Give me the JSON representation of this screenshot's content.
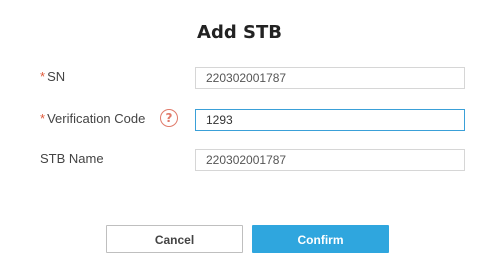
{
  "dialog": {
    "title": "Add STB"
  },
  "form": {
    "sn": {
      "required_mark": "*",
      "label": "SN",
      "value": "220302001787"
    },
    "verification_code": {
      "required_mark": "*",
      "label": "Verification Code",
      "help_icon": "?",
      "value": "1293"
    },
    "stb_name": {
      "label": "STB Name",
      "value": "220302001787"
    }
  },
  "buttons": {
    "cancel_label": "Cancel",
    "confirm_label": "Confirm"
  },
  "colors": {
    "required": "#e05a3a",
    "accent": "#2fa6de",
    "help_icon": "#e07a6a"
  }
}
